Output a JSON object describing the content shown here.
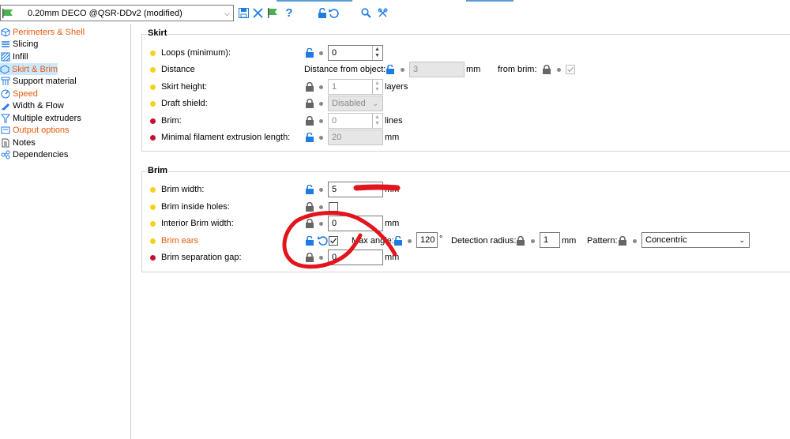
{
  "toolbar": {
    "preset": "0.20mm DECO @QSR-DDv2 (modified)",
    "icons": [
      "flag-icon",
      "save-icon",
      "delete-icon",
      "flag-icon",
      "help-icon",
      "lock-icon",
      "undo-icon",
      "search-icon",
      "compare-icon"
    ]
  },
  "sidebar": {
    "items": [
      {
        "label": "Perimeters & Shell",
        "icon": "cube-icon",
        "modified": true
      },
      {
        "label": "Slicing",
        "icon": "layers-icon",
        "modified": false
      },
      {
        "label": "Infill",
        "icon": "infill-icon",
        "modified": false
      },
      {
        "label": "Skirt & Brim",
        "icon": "skirt-icon",
        "modified": true,
        "selected": true
      },
      {
        "label": "Support material",
        "icon": "support-icon",
        "modified": false
      },
      {
        "label": "Speed",
        "icon": "speed-icon",
        "modified": true
      },
      {
        "label": "Width & Flow",
        "icon": "width-icon",
        "modified": false
      },
      {
        "label": "Multiple extruders",
        "icon": "extruders-icon",
        "modified": false
      },
      {
        "label": "Output options",
        "icon": "output-icon",
        "modified": true
      },
      {
        "label": "Notes",
        "icon": "notes-icon",
        "modified": false
      },
      {
        "label": "Dependencies",
        "icon": "dependencies-icon",
        "modified": false
      }
    ]
  },
  "skirt": {
    "title": "Skirt",
    "loops_label": "Loops (minimum):",
    "loops_value": "0",
    "distance_label": "Distance",
    "distance_from_object_label": "Distance from object:",
    "distance_value": "3",
    "distance_unit": "mm",
    "from_brim_label": "from brim:",
    "from_brim_checked": true,
    "skirt_height_label": "Skirt height:",
    "skirt_height_value": "1",
    "skirt_height_unit": "layers",
    "draft_shield_label": "Draft shield:",
    "draft_shield_value": "Disabled",
    "brim_label": "Brim:",
    "brim_value": "0",
    "brim_unit": "lines",
    "min_filament_label": "Minimal filament extrusion length:",
    "min_filament_value": "20",
    "min_filament_unit": "mm"
  },
  "brim": {
    "title": "Brim",
    "width_label": "Brim width:",
    "width_value": "5",
    "width_unit": "mm",
    "inside_holes_label": "Brim inside holes:",
    "inside_holes_checked": false,
    "interior_width_label": "Interior Brim width:",
    "interior_width_value": "0",
    "interior_width_unit": "mm",
    "ears_label": "Brim ears",
    "ears_checked": true,
    "max_angle_label": "Max angle:",
    "max_angle_value": "120",
    "max_angle_unit": "°",
    "detection_radius_label": "Detection radius:",
    "detection_radius_value": "1",
    "detection_radius_unit": "mm",
    "pattern_label": "Pattern:",
    "pattern_value": "Concentric",
    "separation_gap_label": "Brim separation gap:",
    "separation_gap_value": "0",
    "separation_gap_unit": "mm"
  },
  "colors": {
    "modified_text": "#e8590c",
    "unlocked_lock": "#1e7be6",
    "locked_lock": "#666666",
    "annotation": "#e3141b",
    "selection": "#cce8ff"
  }
}
